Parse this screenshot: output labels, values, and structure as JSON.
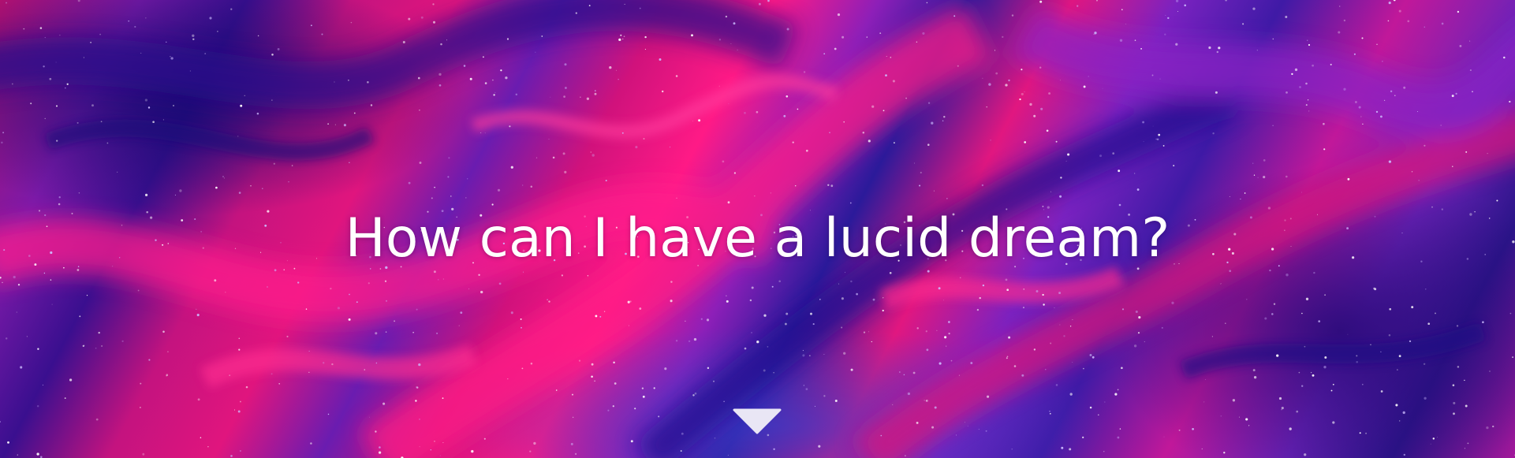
{
  "hero": {
    "headline": "How can I have a lucid dream?",
    "background_palette": [
      "#e0157e",
      "#ff1a86",
      "#7b1aa8",
      "#3a0f8f",
      "#2b1a9a"
    ],
    "text_color": "#ffffff"
  },
  "scroll_cue": {
    "icon": "triangle-down-icon",
    "color": "#e9e6f5"
  }
}
